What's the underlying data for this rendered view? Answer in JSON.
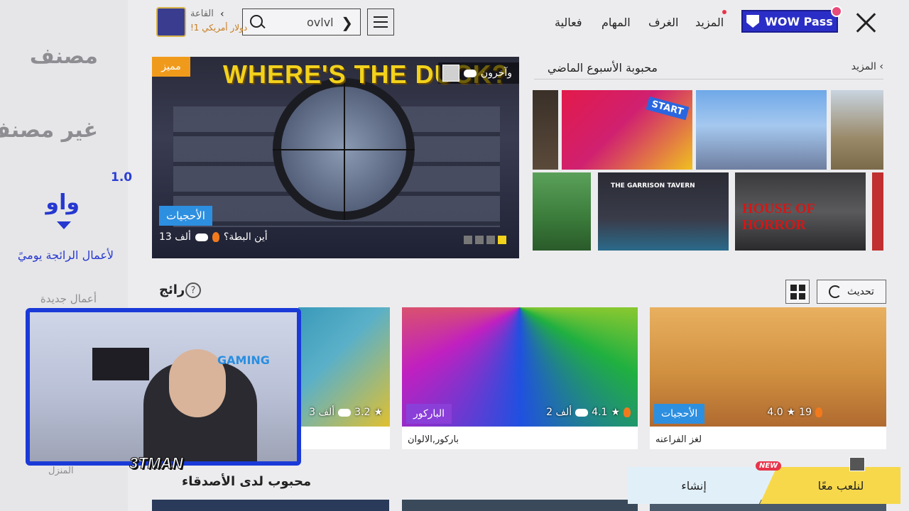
{
  "sidebar": {
    "categories": [
      "مصنف",
      "غير مصنف"
    ],
    "version": "1.0",
    "active_category": "واو",
    "daily_trending": "لأعمال الرائجة يوميً",
    "new_works": "أعمال جديدة",
    "home": "المنزل"
  },
  "topbar": {
    "wow_pass": "WOW Pass",
    "nav": [
      "المزيد",
      "الغرف",
      "المهام",
      "فعالية"
    ],
    "search_value": "ovlvl",
    "hall_label": "القاعة",
    "hall_sub": "!1 دولار أمريكي"
  },
  "featured": {
    "title": "WHERE'S THE DUCK?",
    "badge": "مميز",
    "others": "وآخرون",
    "tag": "الأحجيات",
    "players": "13 ألف",
    "name": "أين البطة؟"
  },
  "popular": {
    "title": "محبوبة الأسبوع الماضي",
    "more": "المزيد",
    "tiles": [
      "START",
      "THE GARRISON TAVERN",
      "HOUSE OF HORROR"
    ]
  },
  "trending": {
    "title": "رائج",
    "refresh": "تحديث",
    "cards": [
      {
        "caption": "لغز الفراعنه",
        "tag": "الأحجيات",
        "players": "19",
        "rating": "4.0",
        "tag_color": "#2d8fe0"
      },
      {
        "caption": "باركور,الالوان",
        "tag": "الباركور",
        "players": "2 ألف",
        "rating": "4.1",
        "tag_color": "#8a3fd8"
      },
      {
        "caption": "",
        "tag": "",
        "players": "3 ألف",
        "rating": "3.2",
        "tag_color": "#2d8fe0"
      }
    ]
  },
  "friends": {
    "title": "محبوب لدى الأصدقاء"
  },
  "actions": {
    "create": "إنشاء",
    "play": "لنلعب معًا",
    "new_badge": "NEW"
  },
  "webcam": {
    "streamer": "3TMAN",
    "sign": "GAMING"
  }
}
